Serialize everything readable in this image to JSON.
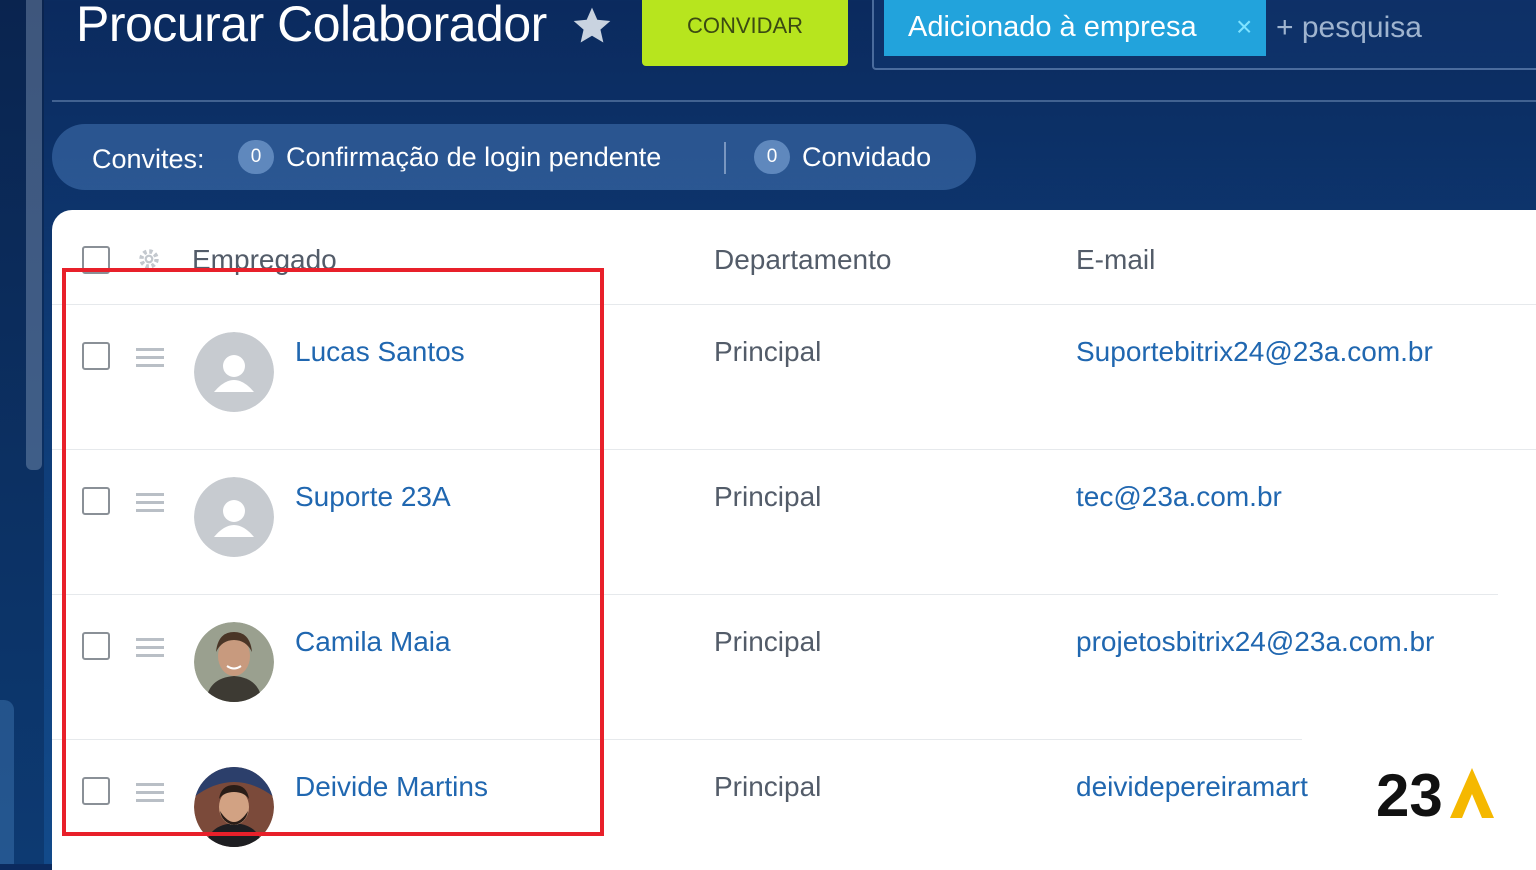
{
  "header": {
    "title": "Procurar Colaborador",
    "invite_button": "CONVIDAR",
    "filter": {
      "tag_label": "Adicionado à empresa",
      "tag_close": "×",
      "add_search": "+ pesquisa"
    }
  },
  "invites": {
    "label": "Convites:",
    "pending_count": "0",
    "pending_label": "Confirmação de login pendente",
    "invited_count": "0",
    "invited_label": "Convidado"
  },
  "table": {
    "columns": [
      "Empregado",
      "Departamento",
      "E-mail"
    ],
    "rows": [
      {
        "name": "Lucas Santos",
        "department": "Principal",
        "email": "Suportebitrix24@23a.com.br",
        "avatar": "default-user-icon"
      },
      {
        "name": "Suporte 23A",
        "department": "Principal",
        "email": "tec@23a.com.br",
        "avatar": "default-user-icon"
      },
      {
        "name": "Camila Maia",
        "department": "Principal",
        "email": "projetosbitrix24@23a.com.br",
        "avatar": "photo"
      },
      {
        "name": "Deivide Martins",
        "department": "Principal",
        "email": "deividepereiramart",
        "avatar": "photo"
      }
    ]
  },
  "brand": {
    "logo_text": "23A",
    "colors": {
      "accent": "#f5b800",
      "text": "#111111"
    }
  },
  "colors": {
    "invite_button": "#b7e51e",
    "filter_tag": "#22a3dc",
    "link": "#2067b0",
    "highlight_box": "#e8202a"
  }
}
